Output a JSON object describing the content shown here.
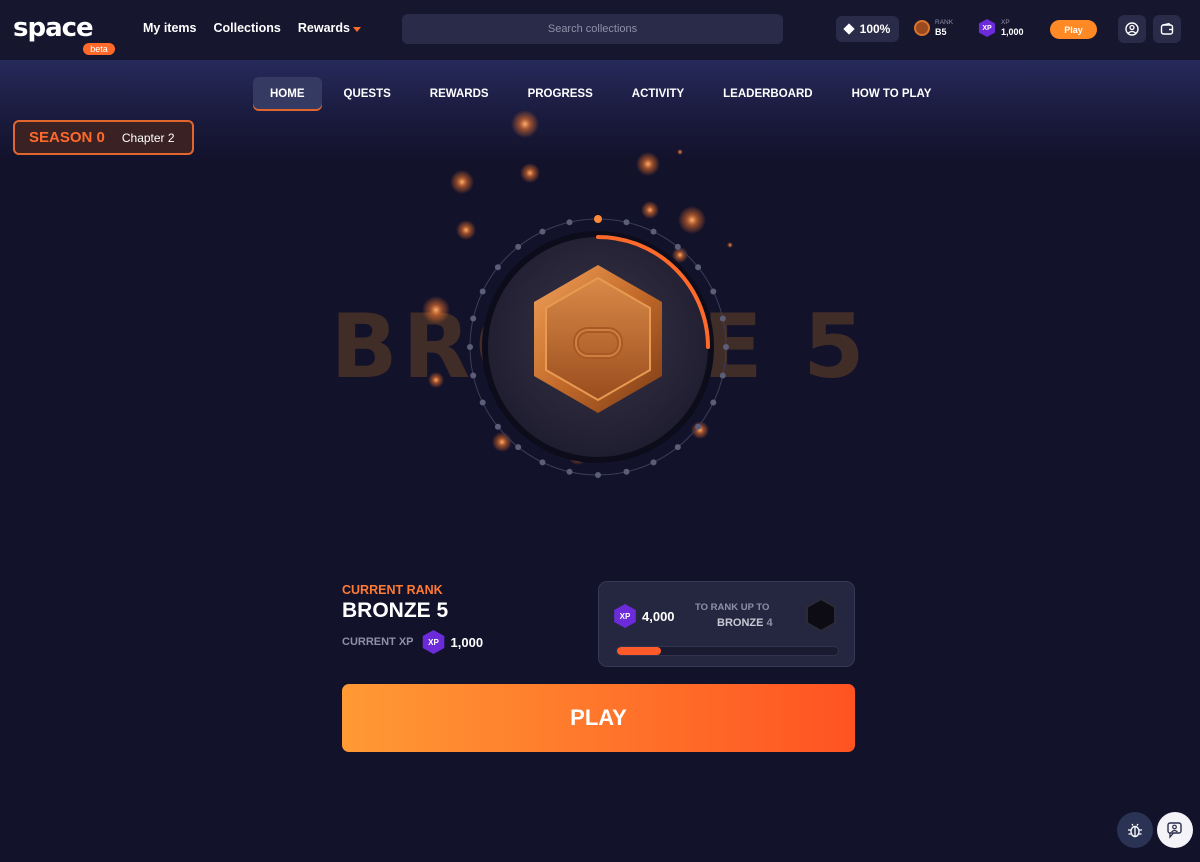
{
  "logo": {
    "text": "space",
    "badge": "beta"
  },
  "nav": {
    "my_items": "My items",
    "collections": "Collections",
    "rewards": "Rewards"
  },
  "search": {
    "placeholder": "Search collections"
  },
  "header_stats": {
    "completion": "100%",
    "rank_label": "RANK",
    "rank_value": "B5",
    "xp_label": "XP",
    "xp_value": "1,000",
    "xp_icon": "XP",
    "play_label": "Play"
  },
  "subnav": [
    "HOME",
    "QUESTS",
    "REWARDS",
    "PROGRESS",
    "ACTIVITY",
    "LEADERBOARD",
    "HOW TO PLAY"
  ],
  "season": {
    "title": "SEASON 0",
    "chapter": "Chapter 2"
  },
  "hero": {
    "rank_text": "BRONZE 5",
    "progress_fraction": 0.25
  },
  "current": {
    "label": "CURRENT RANK",
    "rank": "BRONZE 5",
    "xp_label": "CURRENT XP",
    "xp_value": "1,000",
    "xp_icon": "XP"
  },
  "next": {
    "xp_value": "4,000",
    "xp_icon": "XP",
    "label": "TO RANK UP TO",
    "rank_word": "BRONZE",
    "rank_num": "4",
    "progress": 0.2
  },
  "play_button": "PLAY",
  "colors": {
    "accent": "#ff6a2b",
    "bg": "#13122b",
    "xp_purple": "#6c2bd9",
    "bronze": "#c46b2b"
  },
  "icons": [
    "diamond-icon",
    "rank-badge-icon",
    "xp-icon",
    "user-icon",
    "wallet-icon",
    "bug-icon",
    "support-icon"
  ]
}
